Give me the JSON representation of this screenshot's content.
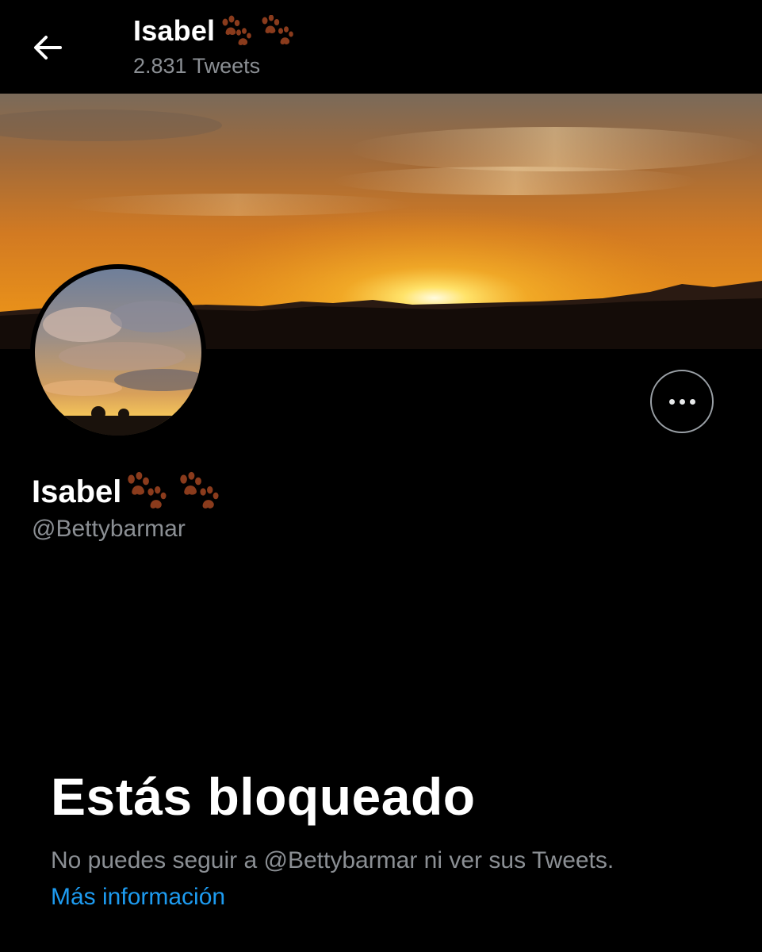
{
  "header": {
    "name": "Isabel",
    "tweet_count": "2.831 Tweets"
  },
  "profile": {
    "name": "Isabel",
    "handle": "@Bettybarmar",
    "name_emoji": "paw-prints-icon"
  },
  "blocked": {
    "title": "Estás bloqueado",
    "description": "No puedes seguir a @Bettybarmar ni ver sus Tweets.",
    "link": "Más información"
  },
  "colors": {
    "background": "#000000",
    "link": "#1d9bf0",
    "muted_text": "#8b8f94",
    "paw": "#8a3b1c"
  },
  "icons": {
    "back": "arrow-left-icon",
    "more": "more-horizontal-icon",
    "paw": "paw-prints-icon"
  }
}
